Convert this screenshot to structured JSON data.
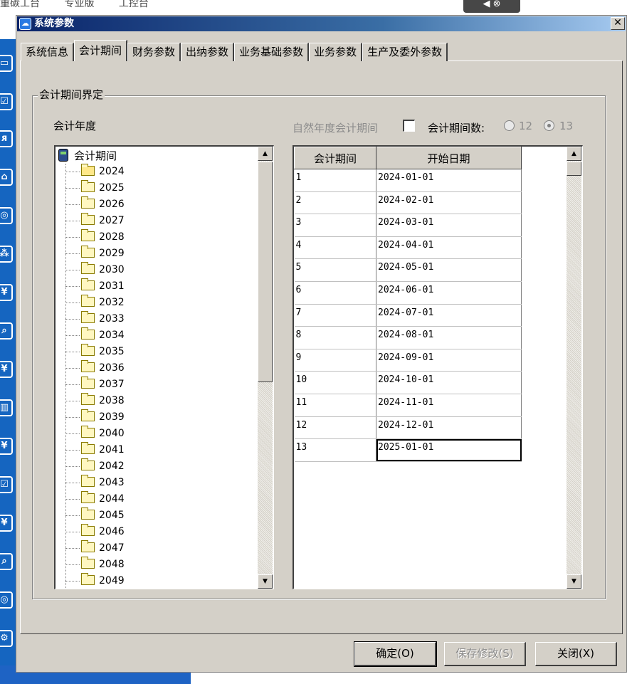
{
  "background": {
    "crumbs": [
      "重碳工台",
      "专业版",
      "工控台"
    ],
    "topbar_icons": [
      "◀",
      "⊗"
    ],
    "sidebar_icons": [
      "▭",
      "☑",
      "ᴙ",
      "⌂",
      "◎",
      "⁂",
      "¥",
      "⌕",
      "¥",
      "▥",
      "¥",
      "☑",
      "¥",
      "⌕",
      "◎",
      "⚙"
    ]
  },
  "dialog": {
    "title": "系统参数",
    "close_glyph": "✕",
    "tabs": [
      "系统信息",
      "会计期间",
      "财务参数",
      "出纳参数",
      "业务基础参数",
      "业务参数",
      "生产及委外参数"
    ],
    "active_tab": "会计期间",
    "group_title": "会计期间界定",
    "year_label": "会计年度",
    "natural_year_label": "自然年度会计期间",
    "period_count_label": "会计期间数:",
    "period_options": [
      "12",
      "13"
    ],
    "selected_period_option": "13",
    "tree": {
      "root": "会计期间",
      "years": [
        "2024",
        "2025",
        "2026",
        "2027",
        "2028",
        "2029",
        "2030",
        "2031",
        "2032",
        "2033",
        "2034",
        "2035",
        "2036",
        "2037",
        "2038",
        "2039",
        "2040",
        "2041",
        "2042",
        "2043",
        "2044",
        "2045",
        "2046",
        "2047",
        "2048",
        "2049"
      ]
    },
    "grid": {
      "columns": [
        "会计期间",
        "开始日期"
      ],
      "rows": [
        [
          "1",
          "2024-01-01"
        ],
        [
          "2",
          "2024-02-01"
        ],
        [
          "3",
          "2024-03-01"
        ],
        [
          "4",
          "2024-04-01"
        ],
        [
          "5",
          "2024-05-01"
        ],
        [
          "6",
          "2024-06-01"
        ],
        [
          "7",
          "2024-07-01"
        ],
        [
          "8",
          "2024-08-01"
        ],
        [
          "9",
          "2024-09-01"
        ],
        [
          "10",
          "2024-10-01"
        ],
        [
          "11",
          "2024-11-01"
        ],
        [
          "12",
          "2024-12-01"
        ],
        [
          "13",
          "2025-01-01"
        ]
      ]
    },
    "buttons": {
      "ok": "确定(O)",
      "save": "保存修改(S)",
      "close": "关闭(X)"
    }
  }
}
